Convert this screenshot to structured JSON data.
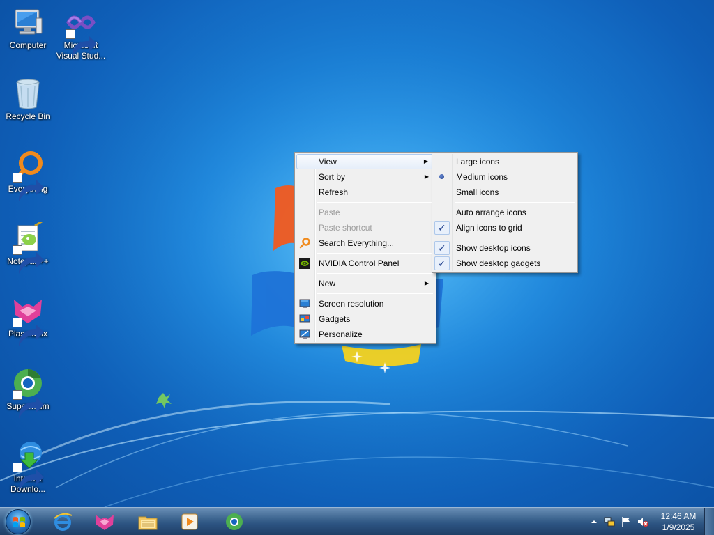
{
  "desktop": {
    "icons": [
      {
        "label": "Computer",
        "icon": "computer-icon"
      },
      {
        "label": "Microsoft Visual Stud...",
        "icon": "visual-studio-icon"
      },
      {
        "label": "Recycle Bin",
        "icon": "recycle-bin-icon"
      },
      {
        "label": "Everything",
        "icon": "everything-icon"
      },
      {
        "label": "Notepad++",
        "icon": "notepad-plus-plus-icon"
      },
      {
        "label": "Plasmafox",
        "icon": "plasmafox-icon"
      },
      {
        "label": "Supermium",
        "icon": "supermium-icon"
      },
      {
        "label": "Internet Downlo...",
        "icon": "internet-download-manager-icon"
      }
    ]
  },
  "context_menu": {
    "items": [
      {
        "label": "View",
        "submenu": true,
        "hover": true
      },
      {
        "label": "Sort by",
        "submenu": true
      },
      {
        "label": "Refresh"
      },
      {
        "label": "Paste",
        "disabled": true
      },
      {
        "label": "Paste shortcut",
        "disabled": true
      },
      {
        "label": "Search Everything...",
        "icon": "search-everything-icon"
      },
      {
        "label": "NVIDIA Control Panel",
        "icon": "nvidia-icon"
      },
      {
        "label": "New",
        "submenu": true
      },
      {
        "label": "Screen resolution",
        "icon": "screen-resolution-icon"
      },
      {
        "label": "Gadgets",
        "icon": "gadgets-icon"
      },
      {
        "label": "Personalize",
        "icon": "personalize-icon"
      }
    ]
  },
  "view_submenu": {
    "items": [
      {
        "label": "Large icons"
      },
      {
        "label": "Medium icons",
        "selected": true,
        "mark": "bullet"
      },
      {
        "label": "Small icons"
      },
      {
        "label": "Auto arrange icons",
        "checked": false
      },
      {
        "label": "Align icons to grid",
        "checked": true
      },
      {
        "label": "Show desktop icons",
        "checked": true
      },
      {
        "label": "Show desktop gadgets",
        "checked": true
      }
    ]
  },
  "taskbar": {
    "pinned": [
      "internet-explorer-icon",
      "plasmafox-icon",
      "file-explorer-icon",
      "media-player-icon",
      "supermium-icon"
    ],
    "tray": [
      "show-hidden-icons-chevron",
      "network-icon",
      "action-center-flag-icon",
      "volume-muted-icon"
    ],
    "clock_time": "12:46 AM",
    "clock_date": "1/9/2025"
  }
}
